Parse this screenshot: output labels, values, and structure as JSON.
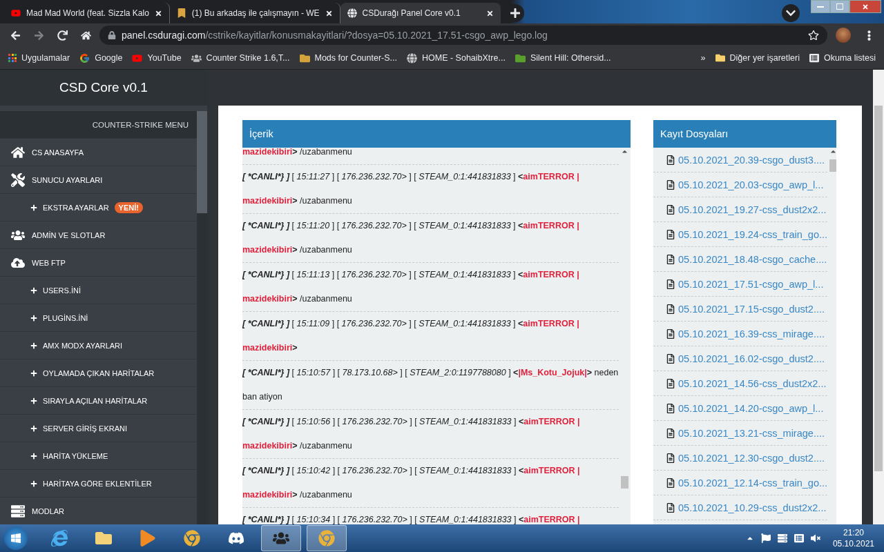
{
  "browser": {
    "tabs": [
      {
        "title": "Mad Mad World (feat. Sizzla Kalo",
        "selected": false
      },
      {
        "title": "(1) Bu arkadaş ile çalışmayın - WE",
        "selected": false
      },
      {
        "title": "CSDurağı Panel Core v0.1",
        "selected": true
      }
    ],
    "address": {
      "domain": "panel.csduragi.com",
      "path": "/cstrike/kayitlar/konusmakayitlari/?dosya=05.10.2021_17.51-csgo_awp_lego.log"
    },
    "bookmarks": [
      "Uygulamalar",
      "Google",
      "YouTube",
      "Counter Strike 1.6,T...",
      "Mods for Counter-S...",
      "HOME - SohaibXtre...",
      "Silent Hill: Othersid..."
    ],
    "bookmarks_more": "»",
    "other_bookmarks": "Diğer yer işaretleri",
    "reading_list": "Okuma listesi"
  },
  "sidebar": {
    "brand": "CSD Core v0.1",
    "menu_title": "COUNTER-STRIKE MENU",
    "items": [
      {
        "kind": "section",
        "label": "CS ANASAYFA"
      },
      {
        "kind": "section",
        "label": "SUNUCU AYARLARI"
      },
      {
        "kind": "sub",
        "label": "EKSTRA AYARLAR",
        "badge": "YENİ!"
      },
      {
        "kind": "section",
        "label": "ADMİN VE SLOTLAR"
      },
      {
        "kind": "section",
        "label": "WEB FTP"
      },
      {
        "kind": "sub",
        "label": "USERS.İNİ"
      },
      {
        "kind": "sub",
        "label": "PLUGİNS.İNİ"
      },
      {
        "kind": "sub",
        "label": "AMX MODX AYARLARI"
      },
      {
        "kind": "sub",
        "label": "OYLAMADA ÇIKAN HARİTALAR"
      },
      {
        "kind": "sub",
        "label": "SIRAYLA AÇILAN HARİTALAR"
      },
      {
        "kind": "sub",
        "label": "SERVER GİRİŞ EKRANI"
      },
      {
        "kind": "sub",
        "label": "HARİTA YÜKLEME"
      },
      {
        "kind": "sub",
        "label": "HARİTAYA GÖRE EKLENTİLER"
      },
      {
        "kind": "section",
        "label": "MODLAR"
      }
    ]
  },
  "log_panel": {
    "title": "İçerik",
    "entries": [
      {
        "parts": [
          {
            "kind": "name",
            "text": "mazidekibiri"
          },
          {
            "kind": "punct",
            "text": ">"
          },
          {
            "kind": "plain",
            "text": " /uzabanmenu"
          }
        ]
      },
      {
        "parts": [
          {
            "kind": "tag",
            "text": "[ *CANLI*} ]"
          },
          {
            "kind": "plain",
            "text": " [ "
          },
          {
            "kind": "meta",
            "text": "15:11:27"
          },
          {
            "kind": "plain",
            "text": " ] [ "
          },
          {
            "kind": "meta",
            "text": "176.236.232.70>"
          },
          {
            "kind": "plain",
            "text": " ] [ "
          },
          {
            "kind": "meta",
            "text": "STEAM_0:1:441831833"
          },
          {
            "kind": "plain",
            "text": " ] "
          },
          {
            "kind": "punct",
            "text": "<"
          },
          {
            "kind": "name",
            "text": "aimTERROR | mazidekibiri"
          },
          {
            "kind": "punct",
            "text": ">"
          },
          {
            "kind": "plain",
            "text": " /uzabanmenu"
          }
        ]
      },
      {
        "parts": [
          {
            "kind": "tag",
            "text": "[ *CANLI*} ]"
          },
          {
            "kind": "plain",
            "text": " [ "
          },
          {
            "kind": "meta",
            "text": "15:11:20"
          },
          {
            "kind": "plain",
            "text": " ] [ "
          },
          {
            "kind": "meta",
            "text": "176.236.232.70>"
          },
          {
            "kind": "plain",
            "text": " ] [ "
          },
          {
            "kind": "meta",
            "text": "STEAM_0:1:441831833"
          },
          {
            "kind": "plain",
            "text": " ] "
          },
          {
            "kind": "punct",
            "text": "<"
          },
          {
            "kind": "name",
            "text": "aimTERROR | mazidekibiri"
          },
          {
            "kind": "punct",
            "text": ">"
          },
          {
            "kind": "plain",
            "text": " /uzabanmenu"
          }
        ]
      },
      {
        "parts": [
          {
            "kind": "tag",
            "text": "[ *CANLI*} ]"
          },
          {
            "kind": "plain",
            "text": " [ "
          },
          {
            "kind": "meta",
            "text": "15:11:13"
          },
          {
            "kind": "plain",
            "text": " ] [ "
          },
          {
            "kind": "meta",
            "text": "176.236.232.70>"
          },
          {
            "kind": "plain",
            "text": " ] [ "
          },
          {
            "kind": "meta",
            "text": "STEAM_0:1:441831833"
          },
          {
            "kind": "plain",
            "text": " ] "
          },
          {
            "kind": "punct",
            "text": "<"
          },
          {
            "kind": "name",
            "text": "aimTERROR | mazidekibiri"
          },
          {
            "kind": "punct",
            "text": ">"
          },
          {
            "kind": "plain",
            "text": " /uzabanmenu"
          }
        ]
      },
      {
        "parts": [
          {
            "kind": "tag",
            "text": "[ *CANLI*} ]"
          },
          {
            "kind": "plain",
            "text": " [ "
          },
          {
            "kind": "meta",
            "text": "15:11:09"
          },
          {
            "kind": "plain",
            "text": " ] [ "
          },
          {
            "kind": "meta",
            "text": "176.236.232.70>"
          },
          {
            "kind": "plain",
            "text": " ] [ "
          },
          {
            "kind": "meta",
            "text": "STEAM_0:1:441831833"
          },
          {
            "kind": "plain",
            "text": " ] "
          },
          {
            "kind": "punct",
            "text": "<"
          },
          {
            "kind": "name",
            "text": "aimTERROR | mazidekibiri"
          },
          {
            "kind": "punct",
            "text": ">"
          }
        ]
      },
      {
        "parts": [
          {
            "kind": "tag",
            "text": "[ *CANLI*} ]"
          },
          {
            "kind": "plain",
            "text": " [ "
          },
          {
            "kind": "meta",
            "text": "15:10:57"
          },
          {
            "kind": "plain",
            "text": " ] [ "
          },
          {
            "kind": "meta",
            "text": "78.173.10.68>"
          },
          {
            "kind": "plain",
            "text": " ] [ "
          },
          {
            "kind": "meta",
            "text": "STEAM_2:0:1197788080"
          },
          {
            "kind": "plain",
            "text": " ] "
          },
          {
            "kind": "punct",
            "text": "<"
          },
          {
            "kind": "name",
            "text": "|Ms_Kotu_Jojuk|"
          },
          {
            "kind": "punct",
            "text": ">"
          },
          {
            "kind": "plain",
            "text": " neden ban atiyon"
          }
        ]
      },
      {
        "parts": [
          {
            "kind": "tag",
            "text": "[ *CANLI*} ]"
          },
          {
            "kind": "plain",
            "text": " [ "
          },
          {
            "kind": "meta",
            "text": "15:10:56"
          },
          {
            "kind": "plain",
            "text": " ] [ "
          },
          {
            "kind": "meta",
            "text": "176.236.232.70>"
          },
          {
            "kind": "plain",
            "text": " ] [ "
          },
          {
            "kind": "meta",
            "text": "STEAM_0:1:441831833"
          },
          {
            "kind": "plain",
            "text": " ] "
          },
          {
            "kind": "punct",
            "text": "<"
          },
          {
            "kind": "name",
            "text": "aimTERROR | mazidekibiri"
          },
          {
            "kind": "punct",
            "text": ">"
          },
          {
            "kind": "plain",
            "text": " /uzabanmenu"
          }
        ]
      },
      {
        "parts": [
          {
            "kind": "tag",
            "text": "[ *CANLI*} ]"
          },
          {
            "kind": "plain",
            "text": " [ "
          },
          {
            "kind": "meta",
            "text": "15:10:42"
          },
          {
            "kind": "plain",
            "text": " ] [ "
          },
          {
            "kind": "meta",
            "text": "176.236.232.70>"
          },
          {
            "kind": "plain",
            "text": " ] [ "
          },
          {
            "kind": "meta",
            "text": "STEAM_0:1:441831833"
          },
          {
            "kind": "plain",
            "text": " ] "
          },
          {
            "kind": "punct",
            "text": "<"
          },
          {
            "kind": "name",
            "text": "aimTERROR | mazidekibiri"
          },
          {
            "kind": "punct",
            "text": ">"
          },
          {
            "kind": "plain",
            "text": " /uzabanmenu"
          }
        ]
      },
      {
        "parts": [
          {
            "kind": "tag",
            "text": "[ *CANLI*} ]"
          },
          {
            "kind": "plain",
            "text": " [ "
          },
          {
            "kind": "meta",
            "text": "15:10:34"
          },
          {
            "kind": "plain",
            "text": " ] [ "
          },
          {
            "kind": "meta",
            "text": "176.236.232.70>"
          },
          {
            "kind": "plain",
            "text": " ] [ "
          },
          {
            "kind": "meta",
            "text": "STEAM_0:1:441831833"
          },
          {
            "kind": "plain",
            "text": " ] "
          },
          {
            "kind": "punct",
            "text": "<"
          },
          {
            "kind": "name",
            "text": "aimTERROR |"
          }
        ]
      }
    ]
  },
  "files_panel": {
    "title": "Kayıt Dosyaları",
    "files": [
      "05.10.2021_20.39-csgo_dust3....",
      "05.10.2021_20.03-csgo_awp_l...",
      "05.10.2021_19.27-css_dust2x2...",
      "05.10.2021_19.24-css_train_go...",
      "05.10.2021_18.48-csgo_cache....",
      "05.10.2021_17.51-csgo_awp_l...",
      "05.10.2021_17.15-csgo_dust2....",
      "05.10.2021_16.39-css_mirage....",
      "05.10.2021_16.02-csgo_dust2....",
      "05.10.2021_14.56-css_dust2x2...",
      "05.10.2021_14.20-csgo_awp_l...",
      "05.10.2021_13.21-css_mirage....",
      "05.10.2021_12.30-csgo_dust2....",
      "05.10.2021_12.14-css_train_go...",
      "05.10.2021_10.29-css_dust2x2..."
    ]
  },
  "taskbar": {
    "time": "21:20",
    "date": "05.10.2021"
  }
}
